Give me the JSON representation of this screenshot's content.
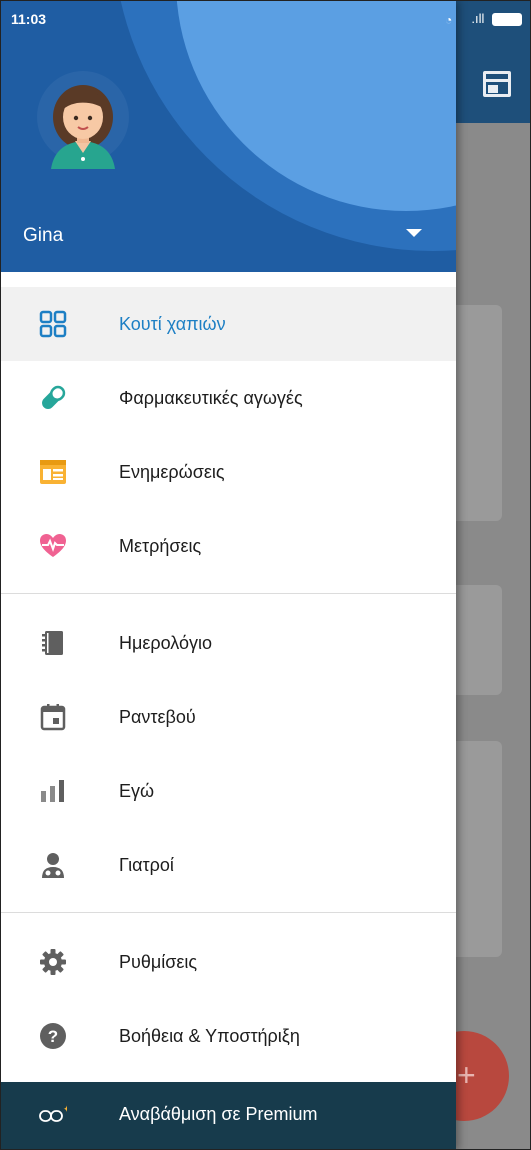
{
  "status_bar": {
    "time": "11:03"
  },
  "user": {
    "name": "Gina"
  },
  "menu": {
    "section1": [
      {
        "label": "Κουτί χαπιών",
        "icon": "grid-icon",
        "active": true
      },
      {
        "label": "Φαρμακευτικές αγωγές",
        "icon": "pill-icon"
      },
      {
        "label": "Ενημερώσεις",
        "icon": "calendar-news-icon"
      },
      {
        "label": "Μετρήσεις",
        "icon": "heart-pulse-icon"
      }
    ],
    "section2": [
      {
        "label": "Ημερολόγιο",
        "icon": "notebook-icon"
      },
      {
        "label": "Ραντεβού",
        "icon": "calendar-icon"
      },
      {
        "label": "Εγώ",
        "icon": "bar-chart-icon"
      },
      {
        "label": "Γιατροί",
        "icon": "doctor-icon"
      }
    ],
    "section3": [
      {
        "label": "Ρυθμίσεις",
        "icon": "gear-icon"
      },
      {
        "label": "Βοήθεια & Υποστήριξη",
        "icon": "help-icon"
      }
    ]
  },
  "premium": {
    "label": "Αναβάθμιση σε Premium",
    "icon": "premium-pills-icon"
  },
  "colors": {
    "active": "#1d7fc4",
    "header": "#1f5da3",
    "premium_bar": "#173b4c"
  }
}
